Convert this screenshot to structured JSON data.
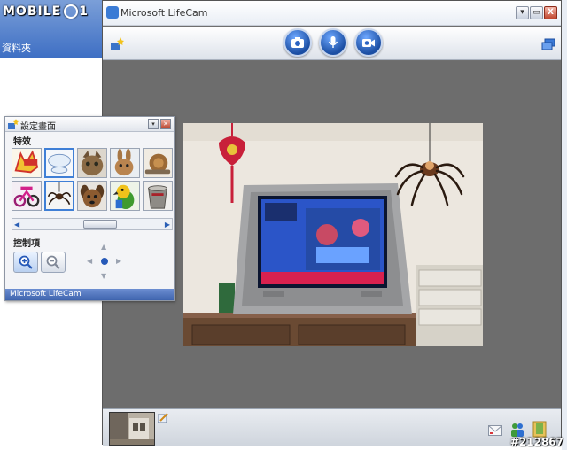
{
  "watermark": {
    "text_left": "MOBILE",
    "text_right": "1",
    "serial": "#212867"
  },
  "background_window": {
    "folder_label": "資料夾"
  },
  "app": {
    "title": "Microsoft LifeCam",
    "window_buttons": {
      "minimize": "▾",
      "restore": "▭",
      "close": "X"
    },
    "toolbar": {
      "icons": [
        "effects-star-icon",
        "camera-icon",
        "microphone-icon",
        "video-camera-icon",
        "window-switch-icon"
      ]
    },
    "bottom_bar": {
      "icons": [
        "pencil-edit-icon",
        "mail-icon",
        "contacts-icon",
        "folder-icon"
      ]
    }
  },
  "settings_panel": {
    "title": "設定畫面",
    "effects_label": "特效",
    "controls_label": "控制項",
    "footer": "Microsoft LifeCam",
    "effects": [
      {
        "name": "comic-burst",
        "selected": false
      },
      {
        "name": "speech-bubble",
        "selected": true
      },
      {
        "name": "cat",
        "selected": false
      },
      {
        "name": "rabbit",
        "selected": false
      },
      {
        "name": "snail",
        "selected": false
      },
      {
        "name": "bicycle",
        "selected": false
      },
      {
        "name": "spider",
        "selected": true
      },
      {
        "name": "dog",
        "selected": false
      },
      {
        "name": "parrot",
        "selected": false
      },
      {
        "name": "bucket",
        "selected": false
      }
    ],
    "scroll": {
      "left_arrow": "◀",
      "right_arrow": "▶"
    },
    "dpad": {
      "up": "▲",
      "down": "▼",
      "left": "◀",
      "right": "▶"
    }
  },
  "colors": {
    "accent": "#2659b8",
    "panel_footer": "#4a6fb8",
    "video_bg": "#6d6d6d"
  }
}
